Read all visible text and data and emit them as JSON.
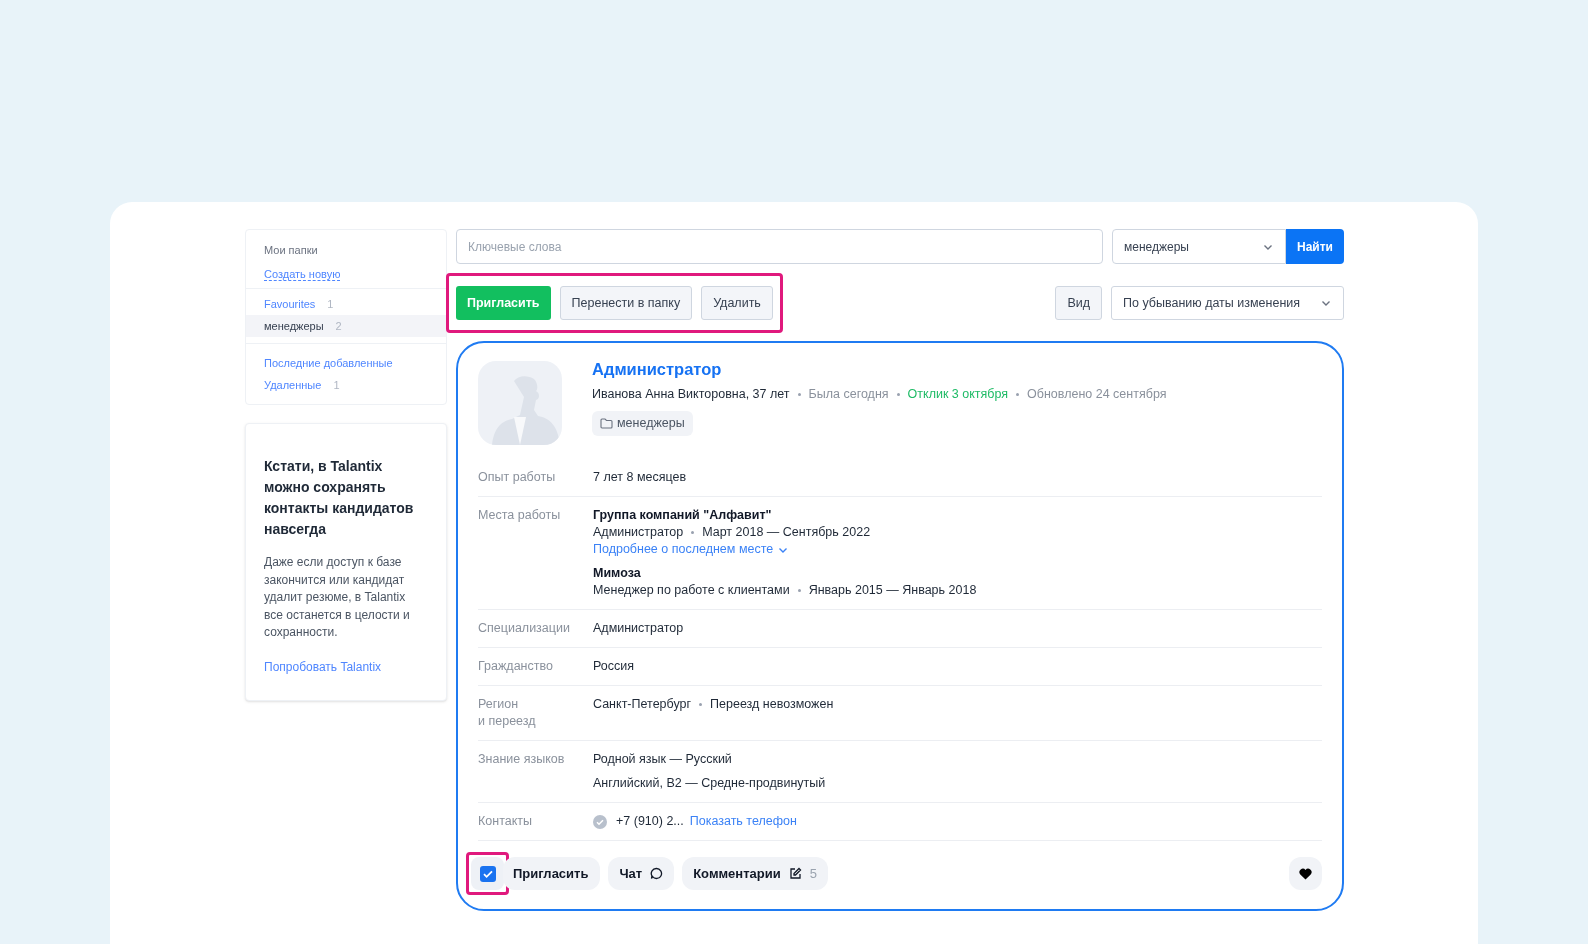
{
  "sidebar": {
    "heading": "Мои папки",
    "create_link": "Создать новую",
    "folders": [
      {
        "name": "Favourites",
        "count": "1",
        "selected": false
      },
      {
        "name": "менеджеры",
        "count": "2",
        "selected": true
      }
    ],
    "other": [
      {
        "name": "Последние добавленные"
      },
      {
        "name": "Удаленные",
        "count": "1"
      }
    ]
  },
  "promo": {
    "title": "Кстати, в Talantix можно сохранять контакты кандидатов навсегда",
    "body": "Даже если доступ к базе закончится или кандидат удалит резюме, в Talantix все останется в целости и сохранности.",
    "link": "Попробовать Talantix"
  },
  "search": {
    "placeholder": "Ключевые слова",
    "folder": "менеджеры",
    "button": "Найти"
  },
  "toolbar": {
    "highlighted": true,
    "buttons": [
      {
        "label": "Пригласить",
        "kind": "primary"
      },
      {
        "label": "Перенести в папку",
        "kind": "secondary"
      },
      {
        "label": "Удалить",
        "kind": "secondary"
      }
    ],
    "view": "Вид",
    "sort": "По убыванию даты изменения"
  },
  "candidate": {
    "title": "Администратор",
    "name_age": "Иванова Анна Викторовна, 37 лет",
    "seen": "Была сегодня",
    "response": "Отклик 3 октября",
    "updated": "Обновлено 24 сентября",
    "folder_tag": "менеджеры",
    "fields": [
      {
        "kind": "text",
        "label": "Опыт работы",
        "lines": [
          "7 лет 8 месяцев"
        ]
      },
      {
        "kind": "jobs",
        "label": "Места работы",
        "jobs": [
          {
            "company": "Группа компаний \"Алфавит\"",
            "position": "Администратор",
            "period": "Март 2018 — Сентябрь 2022",
            "more": "Подробнее о последнем месте"
          },
          {
            "company": "Мимоза",
            "position": "Менеджер по работе с клиентами",
            "period": "Январь 2015 — Январь 2018"
          }
        ]
      },
      {
        "kind": "text",
        "label": "Специализации",
        "lines": [
          "Администратор"
        ]
      },
      {
        "kind": "text",
        "label": "Гражданство",
        "lines": [
          "Россия"
        ]
      },
      {
        "kind": "dotted",
        "label": "Регион\nи переезд",
        "parts": [
          "Санкт-Петербург",
          "Переезд невозможен"
        ]
      },
      {
        "kind": "text",
        "label": "Знание языков",
        "lines": [
          "Родной язык — Русский",
          "Английский, B2 — Средне-продвинутый"
        ]
      },
      {
        "kind": "contacts",
        "label": "Контакты",
        "phone": "+7 (910) 2...",
        "link": "Показать телефон"
      }
    ],
    "footer": {
      "checked": true,
      "highlighted": true,
      "invite": "Пригласить",
      "chat": "Чат",
      "comments": "Комментарии",
      "comments_count": "5"
    }
  }
}
